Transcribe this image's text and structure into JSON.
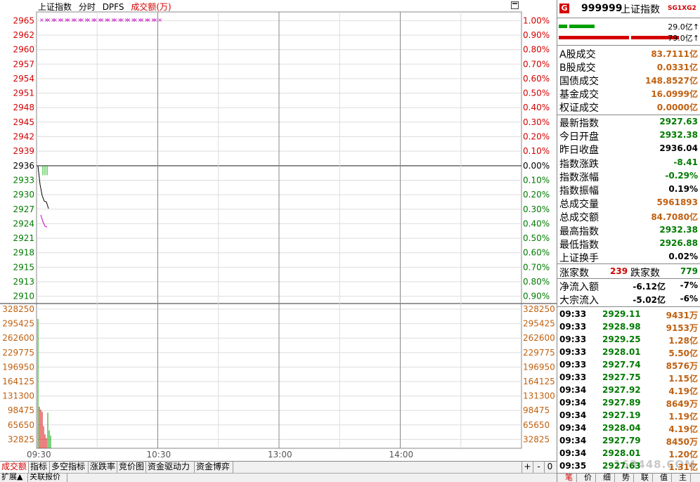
{
  "header": {
    "name": "上证指数",
    "mode": "分时",
    "indicator": "DPFS",
    "volume_label": "成交额(万)"
  },
  "chart_data": {
    "type": "line",
    "price_ticks": [
      2965,
      2962,
      2960,
      2957,
      2954,
      2951,
      2948,
      2945,
      2942,
      2939,
      2936,
      2933,
      2930,
      2927,
      2924,
      2921,
      2918,
      2915,
      2913,
      2910
    ],
    "pct_ticks": [
      "1.00%",
      "0.90%",
      "0.80%",
      "0.70%",
      "0.60%",
      "0.50%",
      "0.40%",
      "0.30%",
      "0.20%",
      "0.10%",
      "0.00%",
      "0.10%",
      "0.20%",
      "0.30%",
      "0.40%",
      "0.50%",
      "0.60%",
      "0.70%",
      "0.80%",
      "0.90%"
    ],
    "volume_ticks": [
      328250,
      295425,
      262600,
      229775,
      196950,
      164125,
      131300,
      98475,
      65650,
      32825
    ],
    "time_ticks": [
      "09:30",
      "10:30",
      "13:00",
      "14:00"
    ],
    "prev_close": 2936.04,
    "ylim": [
      2909,
      2966
    ],
    "price_line": [
      2936.04,
      2932.38,
      2930.2,
      2929.11,
      2928.98,
      2927.63
    ],
    "avg_line": [
      2926.4,
      2925.1,
      2924.2,
      2924.0
    ],
    "dpfs_marks": 18,
    "volume_bars": [
      305000,
      98000,
      91000,
      86000,
      52000,
      33000,
      24000,
      84000,
      42000,
      30000
    ],
    "colors": {
      "up": "#d40000",
      "down": "#00a000",
      "price": "#000000",
      "avg": "#c000c0"
    }
  },
  "tabs": [
    "成交额",
    "指标",
    "多空指标",
    "涨跌率",
    "竞价图",
    "资金驱动力",
    "资金博弈"
  ],
  "tab_controls": [
    "+",
    "-",
    "0"
  ],
  "bottom_tabs": [
    "扩展▲",
    "关联报价"
  ],
  "panel": {
    "badge": "G",
    "code": "999999",
    "name": "上证指数",
    "tag": "SG1XG2",
    "bar1_value": "29.0亿↑",
    "bar2_value": "79.0亿↑",
    "volume_rows": [
      {
        "label": "A股成交",
        "value": "83.7111亿"
      },
      {
        "label": "B股成交",
        "value": "0.0331亿"
      },
      {
        "label": "国债成交",
        "value": "148.8527亿"
      },
      {
        "label": "基金成交",
        "value": "16.0999亿"
      },
      {
        "label": "权证成交",
        "value": "0.0000亿"
      }
    ],
    "index_rows": [
      {
        "label": "最新指数",
        "value": "2927.63",
        "color": "green"
      },
      {
        "label": "今日开盘",
        "value": "2932.38",
        "color": "green"
      },
      {
        "label": "昨日收盘",
        "value": "2936.04",
        "color": "black"
      },
      {
        "label": "指数涨跌",
        "value": "-8.41",
        "color": "green"
      },
      {
        "label": "指数涨幅",
        "value": "-0.29%",
        "color": "green"
      },
      {
        "label": "指数振幅",
        "value": "0.19%",
        "color": "black"
      },
      {
        "label": "总成交量",
        "value": "5961893",
        "color": "brown"
      },
      {
        "label": "总成交额",
        "value": "84.7080亿",
        "color": "brown"
      },
      {
        "label": "最高指数",
        "value": "2932.38",
        "color": "green"
      },
      {
        "label": "最低指数",
        "value": "2926.88",
        "color": "green"
      },
      {
        "label": "上证换手",
        "value": "0.02%",
        "color": "black"
      }
    ],
    "up_label": "涨家数",
    "up_count": "239",
    "down_label": "跌家数",
    "down_count": "779",
    "flow_rows": [
      {
        "label": "净流入额",
        "value": "-6.12亿",
        "pct": "-7%"
      },
      {
        "label": "大宗流入",
        "value": "-5.02亿",
        "pct": "-6%"
      }
    ],
    "ticks": [
      {
        "time": "09:33",
        "price": "2929.11",
        "vol": "9431万"
      },
      {
        "time": "09:33",
        "price": "2928.98",
        "vol": "9153万"
      },
      {
        "time": "09:33",
        "price": "2929.25",
        "vol": "1.28亿"
      },
      {
        "time": "09:33",
        "price": "2928.01",
        "vol": "5.50亿"
      },
      {
        "time": "09:33",
        "price": "2927.74",
        "vol": "8576万"
      },
      {
        "time": "09:33",
        "price": "2927.75",
        "vol": "1.15亿"
      },
      {
        "time": "09:34",
        "price": "2927.92",
        "vol": "4.19亿"
      },
      {
        "time": "09:34",
        "price": "2927.89",
        "vol": "8649万"
      },
      {
        "time": "09:34",
        "price": "2927.19",
        "vol": "1.19亿"
      },
      {
        "time": "09:34",
        "price": "2928.04",
        "vol": "4.19亿"
      },
      {
        "time": "09:34",
        "price": "2927.79",
        "vol": "8450万"
      },
      {
        "time": "09:34",
        "price": "2928.01",
        "vol": "1.20亿"
      },
      {
        "time": "09:35",
        "price": "2927.63",
        "vol": "1.31亿"
      }
    ],
    "watermark": "163448.COM",
    "side_tabs": [
      "笔",
      "价",
      "细",
      "势",
      "联",
      "值",
      "主"
    ]
  }
}
